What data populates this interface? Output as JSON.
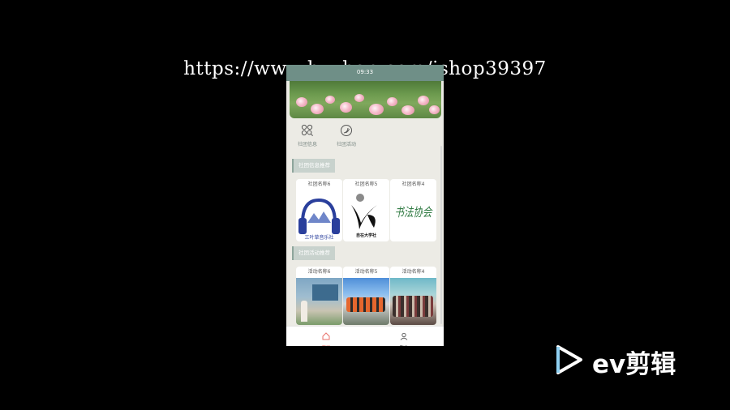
{
  "watermark": "https://www.huzhan.com/ishop39397",
  "status_time": "09:33",
  "menu": [
    {
      "label": "社团信息",
      "icon": "grid-search-icon"
    },
    {
      "label": "社团活动",
      "icon": "activity-ring-icon"
    }
  ],
  "sections": {
    "clubs_title": "社团信息推荐",
    "activities_title": "社团活动推荐"
  },
  "clubs": [
    {
      "name": "社团名称6",
      "logo_text": "三叶草音乐社"
    },
    {
      "name": "社团名称5",
      "logo_text": "自在大学社"
    },
    {
      "name": "社团名称4",
      "logo_text": "书法协会"
    }
  ],
  "activities": [
    {
      "name": "活动名称6"
    },
    {
      "name": "活动名称5"
    },
    {
      "name": "活动名称4"
    }
  ],
  "tabbar": {
    "home": "首页",
    "mine": "我的"
  },
  "brand": {
    "name": "ev剪辑"
  },
  "colors": {
    "header": "#6f8f87",
    "home_active": "#e8726a",
    "section_bg": "#c8d2cd"
  }
}
